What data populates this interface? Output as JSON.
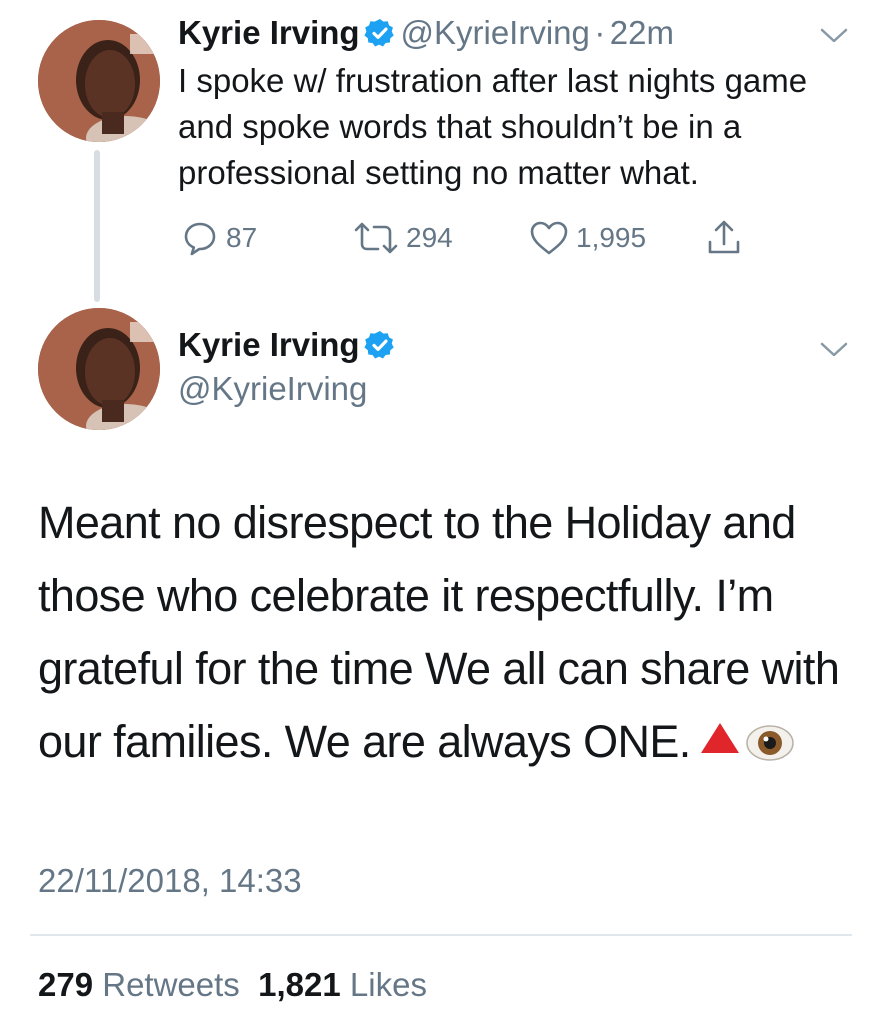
{
  "thread_tweet": {
    "display_name": "Kyrie Irving",
    "handle": "@KyrieIrving",
    "separator": "·",
    "time_ago": "22m",
    "text": "I spoke w/ frustration after last nights game and spoke words that shouldn’t be in a professional setting no matter what.",
    "replies": "87",
    "retweets": "294",
    "likes": "1,995",
    "icons": {
      "verified": "verified-badge-icon",
      "reply": "reply-icon",
      "retweet": "retweet-icon",
      "like": "heart-icon",
      "share": "share-icon",
      "menu": "chevron-down-icon"
    }
  },
  "main_tweet": {
    "display_name": "Kyrie Irving",
    "handle": "@KyrieIrving",
    "text": "Meant no disrespect to the Holiday and those who celebrate it respectfully.  I’m grateful for the time We all can share with our families. We are always ONE.",
    "emojis": [
      "red-triangle-emoji",
      "eye-emoji"
    ],
    "timestamp": "22/11/2018, 14:33",
    "retweet_count": "279",
    "retweet_label": "Retweets",
    "like_count": "1,821",
    "like_label": "Likes"
  },
  "colors": {
    "text_primary": "#14171a",
    "text_secondary": "#657786",
    "verified_blue": "#1da1f2",
    "divider": "#e1e8ed"
  }
}
